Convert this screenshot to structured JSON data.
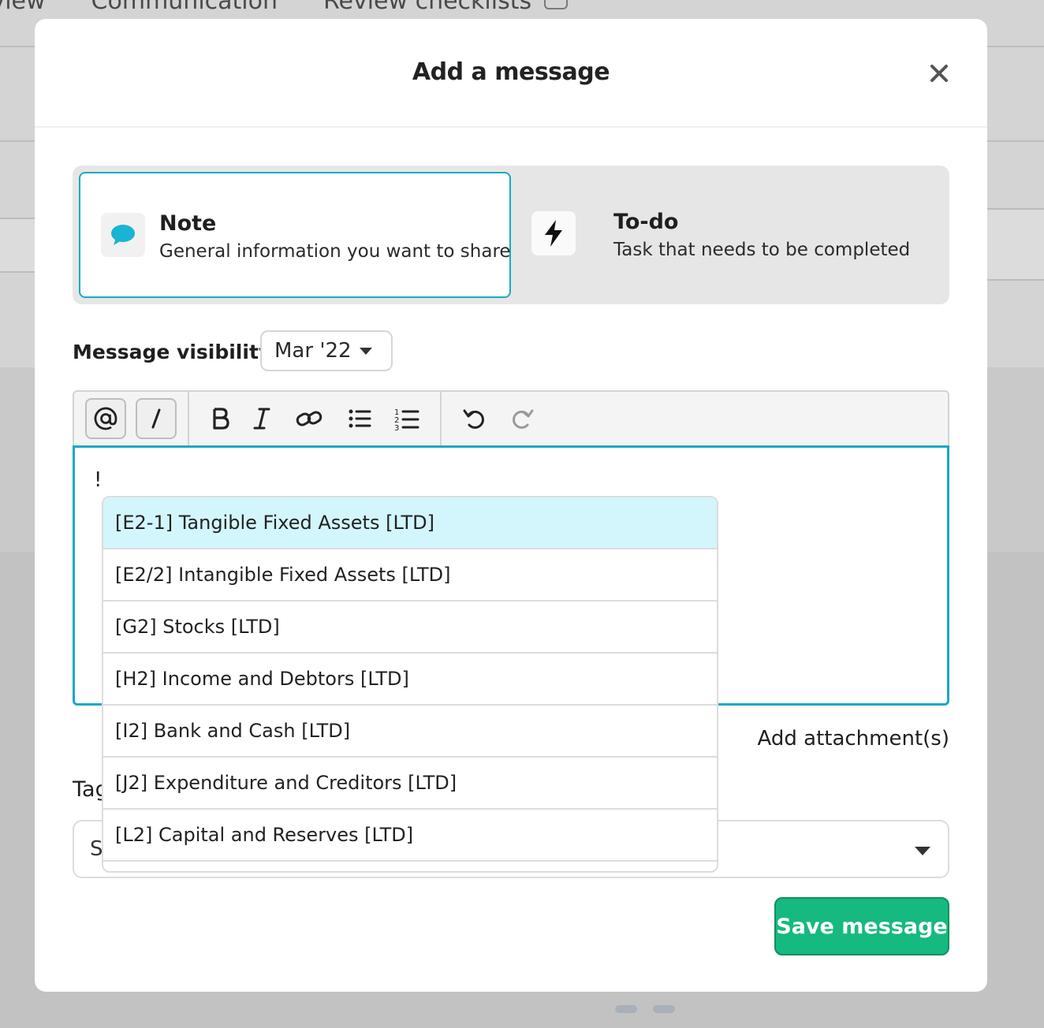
{
  "background": {
    "tabs": [
      "eview",
      "Communication",
      "Review checklists"
    ]
  },
  "modal": {
    "title": "Add a message",
    "close_icon": "close-icon",
    "type_options": [
      {
        "title": "Note",
        "subtitle": "General information you want to share",
        "icon": "speech-bubble-icon",
        "selected": true
      },
      {
        "title": "To-do",
        "subtitle": "Task that needs to be completed",
        "icon": "lightning-bolt-icon",
        "selected": false
      }
    ],
    "visibility": {
      "label": "Message visibility",
      "value": "Mar '22"
    },
    "toolbar": {
      "buttons": [
        "mention-icon",
        "slash-icon",
        "bold-icon",
        "italic-icon",
        "link-icon",
        "bullet-list-icon",
        "numbered-list-icon",
        "undo-icon",
        "redo-icon"
      ]
    },
    "editor": {
      "text": "!"
    },
    "mention_suggestions": [
      "[E2-1] Tangible Fixed Assets [LTD]",
      "[E2/2] Intangible Fixed Assets [LTD]",
      "[G2] Stocks [LTD]",
      "[H2] Income and Debtors [LTD]",
      "[I2] Bank and Cash [LTD]",
      "[J2] Expenditure and Creditors [LTD]",
      "[L2] Capital and Reserves [LTD]"
    ],
    "attachment_label": "Add attachment(s)",
    "tags": {
      "label": "Tag",
      "placeholder": "S"
    },
    "save_label": "Save message",
    "colors": {
      "accent": "#1aa9c3",
      "save": "#16b97f",
      "highlight": "#d2f6fb"
    }
  }
}
